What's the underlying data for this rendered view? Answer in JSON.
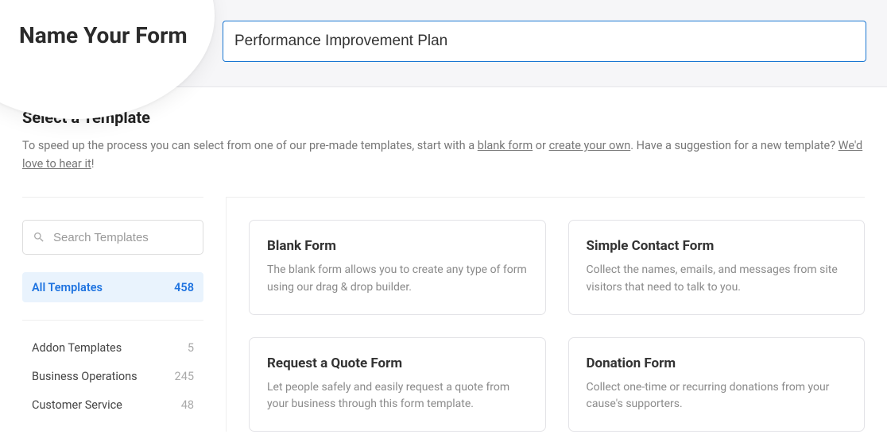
{
  "header": {
    "title": "Name Your Form",
    "form_name_value": "Performance Improvement Plan"
  },
  "select": {
    "heading": "Select a Template",
    "desc_prefix": "To speed up the process you can select from one of our pre-made templates, start with a ",
    "link_blank": "blank form",
    "desc_or": " or ",
    "link_create": "create your own",
    "desc_mid": ". Have a suggestion for a new template? ",
    "link_hear": "We'd love to hear it",
    "desc_suffix": "!"
  },
  "search": {
    "placeholder": "Search Templates"
  },
  "categories": {
    "active": {
      "label": "All Templates",
      "count": "458"
    },
    "items": [
      {
        "label": "Addon Templates",
        "count": "5"
      },
      {
        "label": "Business Operations",
        "count": "245"
      },
      {
        "label": "Customer Service",
        "count": "48"
      }
    ]
  },
  "templates": [
    {
      "title": "Blank Form",
      "desc": "The blank form allows you to create any type of form using our drag & drop builder."
    },
    {
      "title": "Simple Contact Form",
      "desc": "Collect the names, emails, and messages from site visitors that need to talk to you."
    },
    {
      "title": "Request a Quote Form",
      "desc": "Let people safely and easily request a quote from your business through this form template."
    },
    {
      "title": "Donation Form",
      "desc": "Collect one-time or recurring donations from your cause's supporters."
    }
  ]
}
